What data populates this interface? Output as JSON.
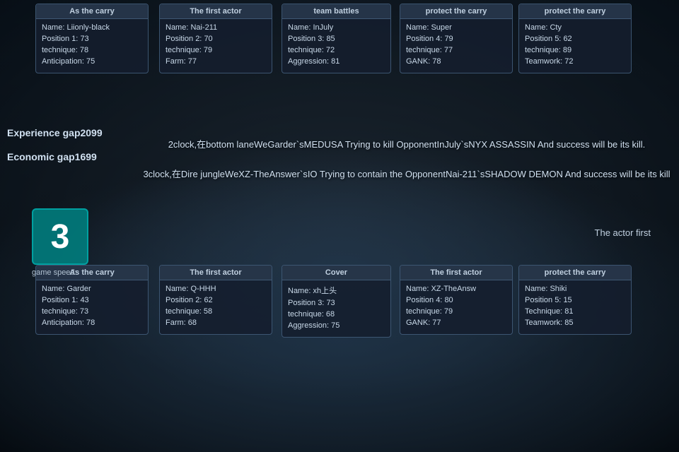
{
  "background": {
    "color": "#1a2a3a"
  },
  "left_stats": {
    "experience_label": "Experience gap2099",
    "economic_label": "Economic gap1699"
  },
  "speed": {
    "number": "3",
    "label": "game speed:"
  },
  "center_text": {
    "line1": "2clock,在bottom laneWeGarder`sMEDUSA Trying to kill OpponentInJuly`sNYX ASSASSIN And success will be its kill.",
    "line2": "3clock,在Dire jungleWeXZ-TheAnswer`sIO Trying to contain the OpponentNai-211`sSHADOW DEMON And success will be its kill"
  },
  "actor_first_text": "The actor first",
  "top_cards": [
    {
      "header": "As the carry",
      "name": "Liionly-black",
      "position_label": "Position 1:",
      "position_value": "73",
      "technique_label": "technique:",
      "technique_value": "78",
      "extra_label": "Anticipation:",
      "extra_value": "75"
    },
    {
      "header": "The first actor",
      "name": "Nai-211",
      "position_label": "Position 2:",
      "position_value": "70",
      "technique_label": "technique:",
      "technique_value": "79",
      "extra_label": "Farm:",
      "extra_value": "77"
    },
    {
      "header": "team battles",
      "name": "InJuly",
      "position_label": "Position 3:",
      "position_value": "85",
      "technique_label": "technique:",
      "technique_value": "72",
      "extra_label": "Aggression:",
      "extra_value": "81"
    },
    {
      "header": "protect the carry",
      "name": "Super",
      "position_label": "Position 4:",
      "position_value": "79",
      "technique_label": "technique:",
      "technique_value": "77",
      "extra_label": "GANK:",
      "extra_value": "78"
    },
    {
      "header": "protect the carry",
      "name": "Cty",
      "position_label": "Position 5:",
      "position_value": "62",
      "technique_label": "technique:",
      "technique_value": "89",
      "extra_label": "Teamwork:",
      "extra_value": "72"
    }
  ],
  "bottom_cards": [
    {
      "header": "As the carry",
      "name": "Garder",
      "position_label": "Position 1:",
      "position_value": "43",
      "technique_label": "technique:",
      "technique_value": "73",
      "extra_label": "Anticipation:",
      "extra_value": "78"
    },
    {
      "header": "The first actor",
      "name": "Q-HHH",
      "position_label": "Position 2:",
      "position_value": "62",
      "technique_label": "technique:",
      "technique_value": "58",
      "extra_label": "Farm:",
      "extra_value": "68"
    },
    {
      "header": "Cover",
      "name": "xh上头",
      "position_label": "Position 3:",
      "position_value": "73",
      "technique_label": "technique:",
      "technique_value": "68",
      "extra_label": "Aggression:",
      "extra_value": "75"
    },
    {
      "header": "The first actor",
      "name": "XZ-TheAnsw",
      "position_label": "Position 4:",
      "position_value": "80",
      "technique_label": "technique:",
      "technique_value": "79",
      "extra_label": "GANK:",
      "extra_value": "77"
    },
    {
      "header": "protect the carry",
      "name": "Shiki",
      "position_label": "Position 5:",
      "position_value": "15",
      "technique_label": "Technique:",
      "technique_value": "81",
      "extra_label": "Teamwork:",
      "extra_value": "85"
    }
  ]
}
